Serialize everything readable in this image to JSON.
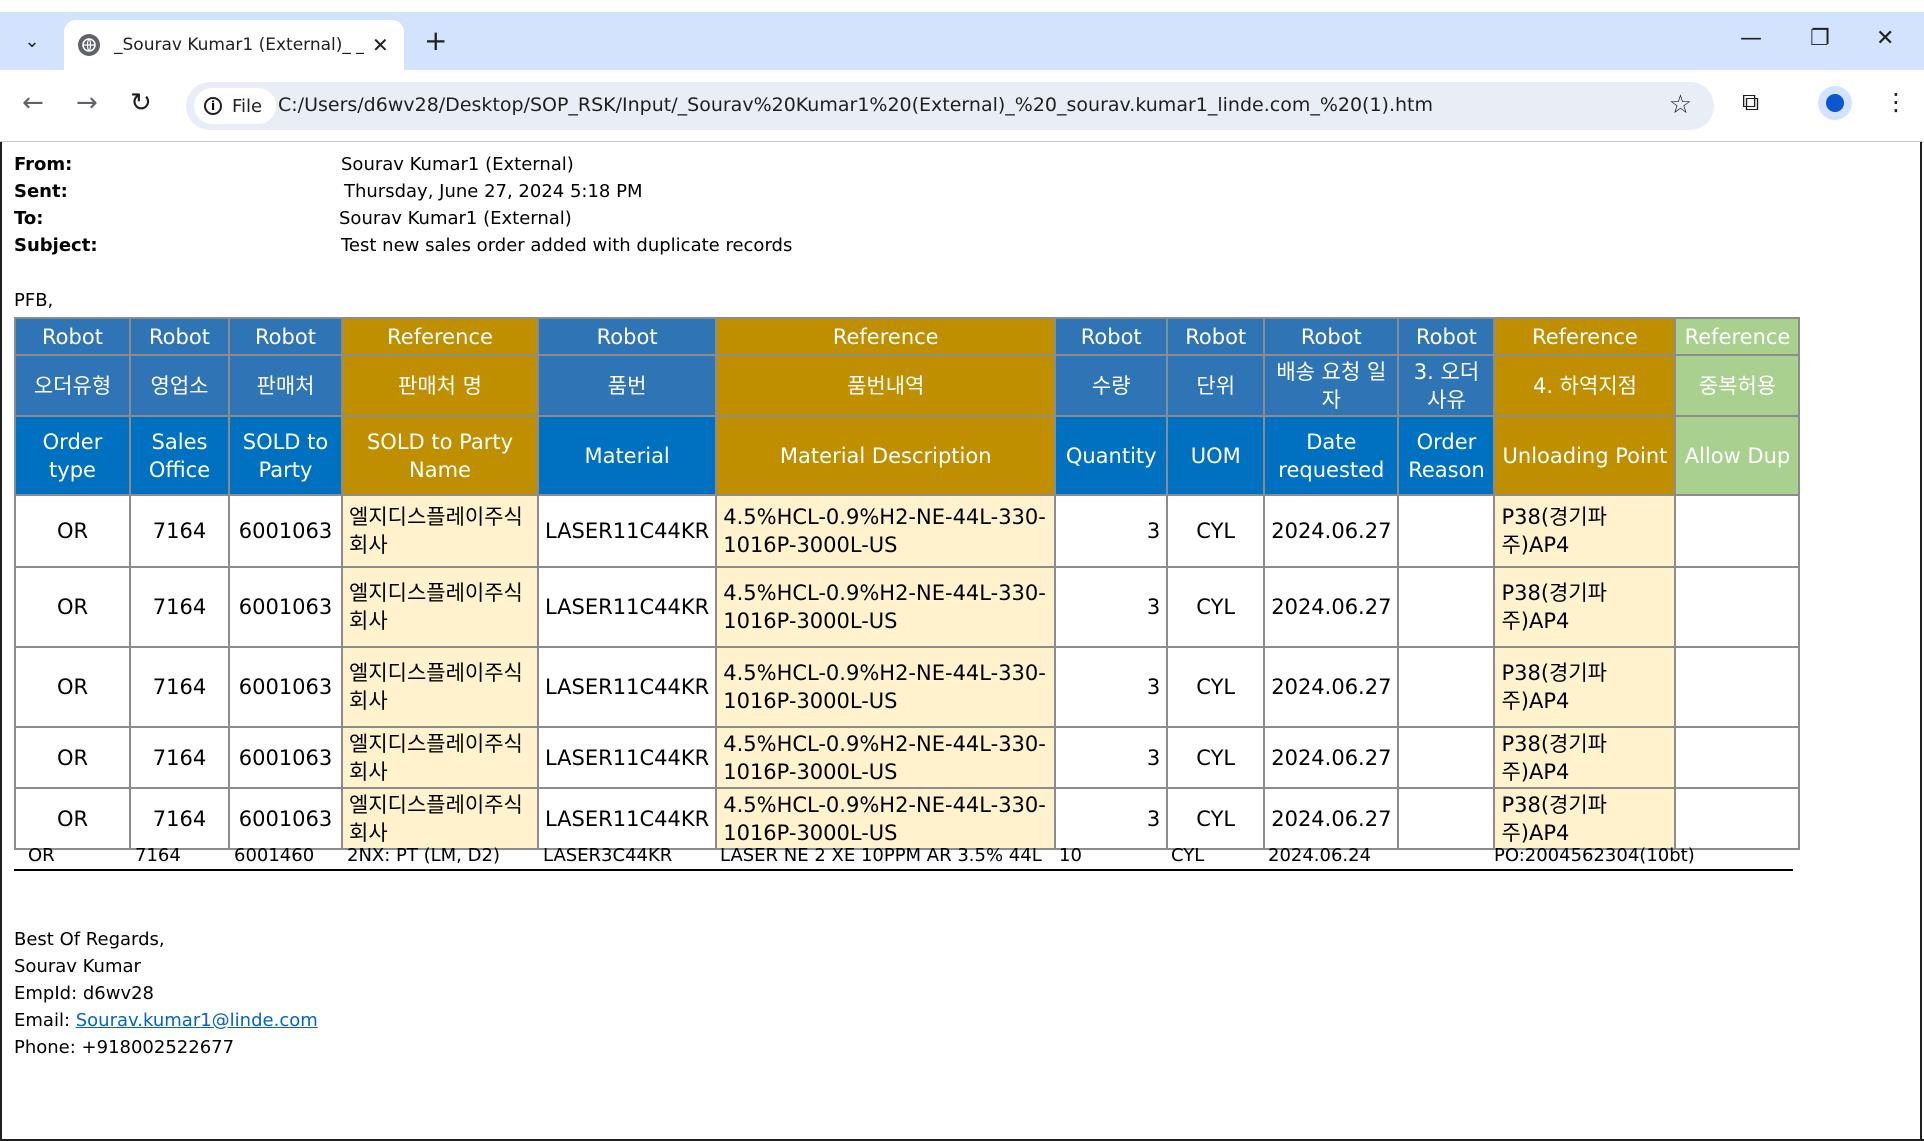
{
  "browser": {
    "tab_title": "_Sourav Kumar1 (External)_ _sou",
    "site_chip": "File",
    "url": "C:/Users/d6wv28/Desktop/SOP_RSK/Input/_Sourav%20Kumar1%20(External)_%20_sourav.kumar1_linde.com_%20(1).htm"
  },
  "email": {
    "from_label": "From:",
    "from": "Sourav Kumar1 (External)",
    "sent_label": "Sent:",
    "sent": "Thursday, June 27, 2024 5:18 PM",
    "to_label": "To:",
    "to": "Sourav Kumar1 (External)",
    "subject_label": "Subject:",
    "subject": "Test new sales order added with duplicate records",
    "greeting": "PFB,"
  },
  "table": {
    "row1": [
      "Robot",
      "Robot",
      "Robot",
      "Reference",
      "Robot",
      "Reference",
      "Robot",
      "Robot",
      "Robot",
      "Robot",
      "Reference",
      "Reference"
    ],
    "row2": [
      "오더유형",
      "영업소",
      "판매처",
      "판매처 명",
      "품번",
      "품번내역",
      "수량",
      "단위",
      "배송 요청 일자",
      "3. 오더 사유",
      "4. 하역지점",
      "중복허용"
    ],
    "row3": [
      "Order type",
      "Sales Office",
      "SOLD to Party",
      "SOLD to Party Name",
      "Material",
      "Material Description",
      "Quantity",
      "UOM",
      "Date requested",
      "Order Reason",
      "Unloading Point",
      "Allow Dup"
    ],
    "rows": [
      [
        "OR",
        "7164",
        "6001063",
        "엘지디스플레이주식회사",
        "LASER11C44KR",
        "4.5%HCL-0.9%H2-NE-44L-330-1016P-3000L-US",
        "3",
        "CYL",
        "2024.06.27",
        "",
        "P38(경기파주)AP4",
        ""
      ],
      [
        "OR",
        "7164",
        "6001063",
        "엘지디스플레이주식회사",
        "LASER11C44KR",
        "4.5%HCL-0.9%H2-NE-44L-330-1016P-3000L-US",
        "3",
        "CYL",
        "2024.06.27",
        "",
        "P38(경기파주)AP4",
        ""
      ],
      [
        "OR",
        "7164",
        "6001063",
        "엘지디스플레이주식회사",
        "LASER11C44KR",
        "4.5%HCL-0.9%H2-NE-44L-330-1016P-3000L-US",
        "3",
        "CYL",
        "2024.06.27",
        "",
        "P38(경기파주)AP4",
        ""
      ],
      [
        "OR",
        "7164",
        "6001063",
        "엘지디스플레이주식회사",
        "LASER11C44KR",
        "4.5%HCL-0.9%H2-NE-44L-330-1016P-3000L-US",
        "3",
        "CYL",
        "2024.06.27",
        "",
        "P38(경기파주)AP4",
        ""
      ],
      [
        "OR",
        "7164",
        "6001063",
        "엘지디스플레이주식회사",
        "LASER11C44KR",
        "4.5%HCL-0.9%H2-NE-44L-330-1016P-3000L-US",
        "3",
        "CYL",
        "2024.06.27",
        "",
        "P38(경기파주)AP4",
        ""
      ]
    ],
    "extra_row": [
      "OR",
      "7164",
      "6001460",
      "2NX: PT (LM, D2)",
      "LASER3C44KR",
      "LASER NE 2 XE 10PPM AR 3.5% 44L",
      "10",
      "CYL",
      "2024.06.24",
      "",
      "PO:2004562304(10bt)",
      ""
    ]
  },
  "signature": {
    "line1": "Best Of Regards,",
    "line2": "Sourav Kumar",
    "line3": "EmpId: d6wv28",
    "email_label": "Email: ",
    "email": "Sourav.kumar1@linde.com",
    "phone": "Phone: +918002522677"
  }
}
